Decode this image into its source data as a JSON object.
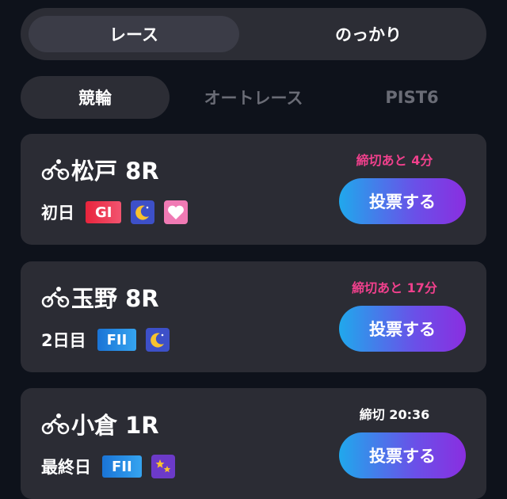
{
  "mode_tabs": [
    {
      "label": "レース",
      "active": true
    },
    {
      "label": "のっかり",
      "active": false
    }
  ],
  "category_tabs": [
    {
      "label": "競輪",
      "active": true
    },
    {
      "label": "オートレース",
      "active": false
    },
    {
      "label": "PIST6",
      "active": false
    }
  ],
  "races": [
    {
      "venue": "松戸 8R",
      "day": "初日",
      "grade": "GI",
      "badges": [
        "moon-icon",
        "heart-icon"
      ],
      "deadline": "締切あと 4分",
      "bet_label": "投票する"
    },
    {
      "venue": "玉野 8R",
      "day": "2日目",
      "grade": "FII",
      "badges": [
        "moon-icon"
      ],
      "deadline": "締切あと 17分",
      "bet_label": "投票する"
    },
    {
      "venue": "小倉 1R",
      "day": "最終日",
      "grade": "FII",
      "badges": [
        "stars-icon"
      ],
      "deadline": "締切 20:36",
      "bet_label": "投票する"
    }
  ],
  "colors": {
    "accent_start": "#20a8ec",
    "accent_end": "#8a2ee0",
    "deadline_warning": "#f0408c"
  }
}
